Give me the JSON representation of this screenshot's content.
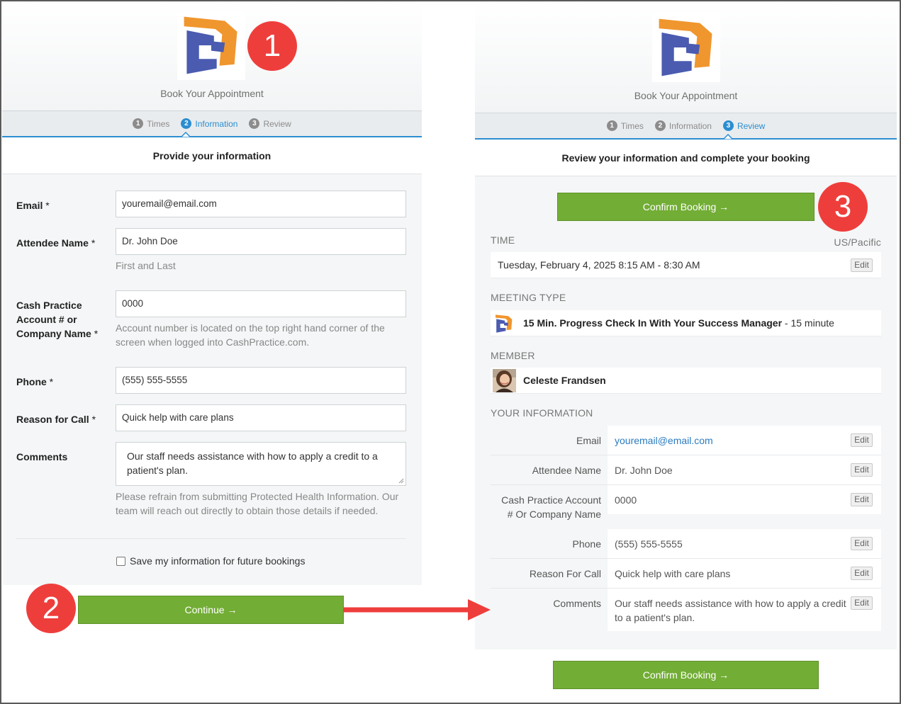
{
  "left": {
    "book_title": "Book Your Appointment",
    "steps": [
      {
        "num": "1",
        "label": "Times"
      },
      {
        "num": "2",
        "label": "Information"
      },
      {
        "num": "3",
        "label": "Review"
      }
    ],
    "active_step": "Information",
    "subheading": "Provide your information",
    "form": {
      "email": {
        "label": "Email",
        "value": "youremail@email.com"
      },
      "attendee": {
        "label": "Attendee Name",
        "value": "Dr. John Doe",
        "help": "First and Last"
      },
      "account": {
        "label_line1": "Cash Practice",
        "label_line2": "Account # or",
        "label_line3": "Company Name",
        "value": "0000",
        "help": "Account number is located on the top right hand corner of the screen when logged into CashPractice.com."
      },
      "phone": {
        "label": "Phone",
        "value": "(555) 555-5555"
      },
      "reason": {
        "label": "Reason for Call",
        "value": "Quick help with care plans"
      },
      "comments": {
        "label": "Comments",
        "value": "Our staff needs assistance with how to apply a credit to a patient's plan.",
        "help": "Please refrain from submitting Protected Health Information. Our team will reach out directly to obtain those details if needed."
      },
      "required_mark": "*",
      "save_label": "Save my information for future bookings"
    },
    "continue_label": "Continue →"
  },
  "right": {
    "book_title": "Book Your Appointment",
    "steps": [
      {
        "num": "1",
        "label": "Times"
      },
      {
        "num": "2",
        "label": "Information"
      },
      {
        "num": "3",
        "label": "Review"
      }
    ],
    "active_step": "Review",
    "subheading": "Review your information and complete your booking",
    "confirm_label": "Confirm Booking →",
    "time": {
      "section": "TIME",
      "timezone": "US/Pacific",
      "value": "Tuesday, February 4, 2025 8:15 AM - 8:30 AM"
    },
    "meeting": {
      "section": "MEETING TYPE",
      "name": "15 Min. Progress Check In With Your Success Manager",
      "duration": " - 15 minute"
    },
    "member": {
      "section": "MEMBER",
      "name": "Celeste Frandsen"
    },
    "your_info": {
      "section": "YOUR INFORMATION",
      "email_label": "Email",
      "email_value": "youremail@email.com",
      "attendee_label": "Attendee Name",
      "attendee_value": "Dr. John Doe",
      "account_label_line1": "Cash Practice Account",
      "account_label_line2": "# Or Company Name",
      "account_value": "0000",
      "phone_label": "Phone",
      "phone_value": "(555) 555-5555",
      "reason_label": "Reason For Call",
      "reason_value": "Quick help with care plans",
      "comments_label": "Comments",
      "comments_value": "Our staff needs assistance with how to apply a credit to a patient's plan."
    },
    "edit_label": "Edit",
    "confirm_bottom_label": "Confirm Booking →"
  },
  "badges": [
    "1",
    "2",
    "3"
  ],
  "colors": {
    "accent_blue": "#2b8dd0",
    "button_green": "#72ad35",
    "badge_red": "#ee3e3c",
    "arrow_red": "#ee3e3c",
    "logo_blue": "#4a5bb0",
    "logo_orange": "#f0962e"
  }
}
